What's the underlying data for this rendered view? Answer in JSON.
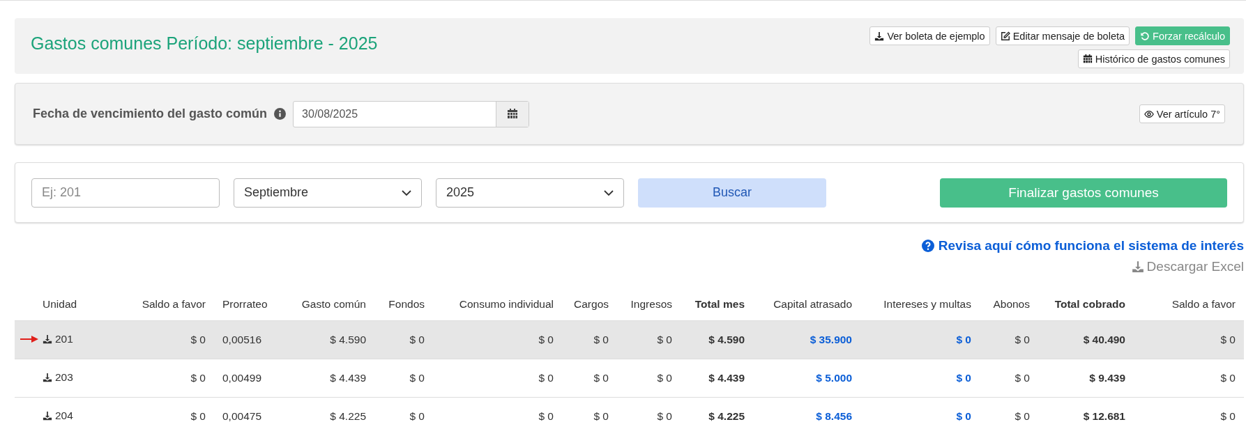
{
  "header": {
    "title": "Gastos comunes Período: septiembre - 2025",
    "actions": [
      {
        "label": "Ver boleta de ejemplo",
        "kind": "download"
      },
      {
        "label": "Editar mensaje de boleta",
        "kind": "edit"
      },
      {
        "label": "Forzar recálculo",
        "kind": "refresh"
      },
      {
        "label": "Histórico de gastos comunes",
        "kind": "calendar"
      }
    ]
  },
  "due_date": {
    "label": "Fecha de vencimiento del gasto común",
    "value": "30/08/2025",
    "article_button": "Ver artículo 7°"
  },
  "filters": {
    "unit_placeholder": "Ej: 201",
    "month": "Septiembre",
    "year": "2025",
    "search_button": "Buscar",
    "finish_button": "Finalizar gastos comunes"
  },
  "interest_link": "Revisa aquí cómo funciona el sistema de interés",
  "excel_button": "Descargar Excel",
  "table": {
    "columns": [
      {
        "label": "Unidad",
        "kind": "unit"
      },
      {
        "label": "Saldo a favor",
        "kind": "money"
      },
      {
        "label": "Prorrateo",
        "kind": "text"
      },
      {
        "label": "Gasto común",
        "kind": "money"
      },
      {
        "label": "Fondos",
        "kind": "money"
      },
      {
        "label": "Consumo individual",
        "kind": "money"
      },
      {
        "label": "Cargos",
        "kind": "money"
      },
      {
        "label": "Ingresos",
        "kind": "money"
      },
      {
        "label": "Total mes",
        "kind": "total"
      },
      {
        "label": "Capital atrasado",
        "kind": "link"
      },
      {
        "label": "Intereses y multas",
        "kind": "link"
      },
      {
        "label": "Abonos",
        "kind": "money"
      },
      {
        "label": "Total cobrado",
        "kind": "total"
      },
      {
        "label": "Saldo a favor",
        "kind": "money"
      }
    ],
    "rows": [
      {
        "selected": true,
        "cells": [
          "201",
          "$ 0",
          "0,00516",
          "$ 4.590",
          "$ 0",
          "$ 0",
          "$ 0",
          "$ 0",
          "$ 4.590",
          "$ 35.900",
          "$ 0",
          "$ 0",
          "$ 40.490",
          "$ 0"
        ]
      },
      {
        "selected": false,
        "cells": [
          "203",
          "$ 0",
          "0,00499",
          "$ 4.439",
          "$ 0",
          "$ 0",
          "$ 0",
          "$ 0",
          "$ 4.439",
          "$ 5.000",
          "$ 0",
          "$ 0",
          "$ 9.439",
          "$ 0"
        ]
      },
      {
        "selected": false,
        "cells": [
          "204",
          "$ 0",
          "0,00475",
          "$ 4.225",
          "$ 0",
          "$ 0",
          "$ 0",
          "$ 0",
          "$ 4.225",
          "$ 8.456",
          "$ 0",
          "$ 0",
          "$ 12.681",
          "$ 0"
        ]
      }
    ]
  }
}
